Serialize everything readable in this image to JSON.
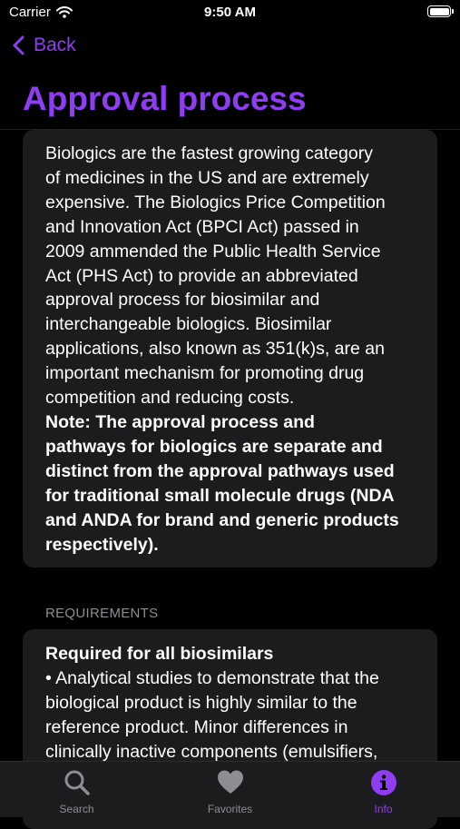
{
  "status_bar": {
    "carrier": "Carrier",
    "time": "9:50 AM",
    "battery_level": 1.0
  },
  "nav": {
    "back_label": "Back",
    "title": "Approval process"
  },
  "intro_card": {
    "paragraph": "Biologics are the fastest growing category\nof medicines in the US and are extremely\nexpensive.  The Biologics Price Competition\nand Innovation Act (BPCI Act) passed in\n2009 ammended the Public Health Service\nAct (PHS Act) to provide an abbreviated\napproval process for biosimilar and\ninterchangeable biologics.  Biosimilar\napplications, also known as 351(k)s, are an\nimportant mechanism for promoting drug\ncompetition and reducing costs.",
    "note": " Note: The approval process and\npathways for biologics are separate and\ndistinct from the approval pathways used\nfor traditional small molecule drugs (NDA\nand ANDA for brand and generic products\nrespectively)."
  },
  "requirements": {
    "section_header": "REQUIREMENTS",
    "heading": "Required for all biosimilars",
    "text": "• Analytical studies to demonstrate that the\nbiological product is highly similar to the\nreference product.  Minor differences in\nclinically inactive components (emulsifiers,"
  },
  "tab_bar": {
    "tabs": [
      {
        "label": "Search",
        "icon": "magnifying-glass-icon",
        "active": false
      },
      {
        "label": "Favorites",
        "icon": "heart-icon",
        "active": false
      },
      {
        "label": "Info",
        "icon": "info-circle-icon",
        "active": true
      }
    ]
  },
  "colors": {
    "accent": "#8e3df2",
    "background": "#000000",
    "card": "#1c1c1e",
    "inactive": "#8d8d93"
  }
}
